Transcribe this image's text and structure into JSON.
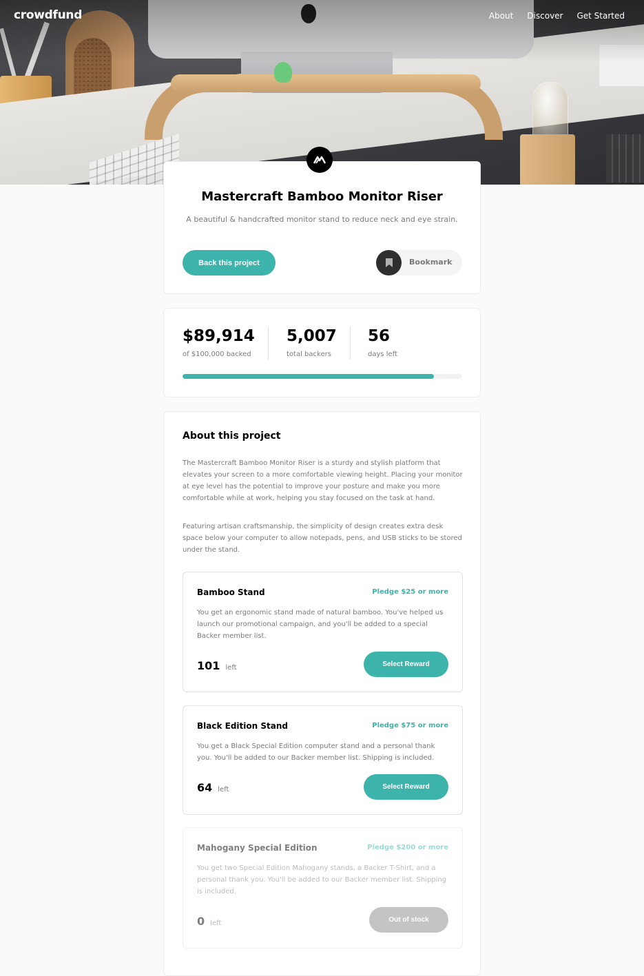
{
  "brand": "crowdfund",
  "nav": [
    "About",
    "Discover",
    "Get Started"
  ],
  "intro": {
    "title": "Mastercraft Bamboo Monitor Riser",
    "subtitle": "A beautiful & handcrafted monitor stand to reduce neck and eye strain.",
    "back_label": "Back this project",
    "bookmark_label": "Bookmark"
  },
  "stats": {
    "backed": "$89,914",
    "backed_label": "of $100,000 backed",
    "backers": "5,007",
    "backers_label": "total backers",
    "days": "56",
    "days_label": "days left",
    "progress_percent": 89.9
  },
  "about": {
    "heading": "About this project",
    "p1": "The Mastercraft Bamboo Monitor Riser is a sturdy and stylish platform that elevates your screen to a more comfortable viewing height. Placing your monitor at eye level has the potential to improve your posture and make you more comfortable while at work, helping you stay focused on the task at hand.",
    "p2": "Featuring artisan craftsmanship, the simplicity of design creates extra desk space below your computer to allow notepads, pens, and USB sticks to be stored under the stand."
  },
  "rewards": [
    {
      "name": "Bamboo Stand",
      "pledge": "Pledge $25 or more",
      "desc": "You get an ergonomic stand made of natural bamboo. You've helped us launch our promotional campaign, and you'll be added to a special Backer member list.",
      "left": "101",
      "left_label": "left",
      "button": "Select Reward"
    },
    {
      "name": "Black Edition Stand",
      "pledge": "Pledge $75 or more",
      "desc": "You get a Black Special Edition computer stand and a personal thank you. You'll be added to our Backer member list. Shipping is included.",
      "left": "64",
      "left_label": "left",
      "button": "Select Reward"
    },
    {
      "name": "Mahogany Special Edition",
      "pledge": "Pledge $200 or more",
      "desc": "You get two Special Edition Mahogany stands, a Backer T-Shirt, and a personal thank you. You'll be added to our Backer member list. Shipping is included.",
      "left": "0",
      "left_label": "left",
      "button": "Out of stock"
    }
  ],
  "colors": {
    "accent": "#3cb3ab",
    "dark": "#2f2f2f",
    "muted": "#7a7a7a"
  }
}
